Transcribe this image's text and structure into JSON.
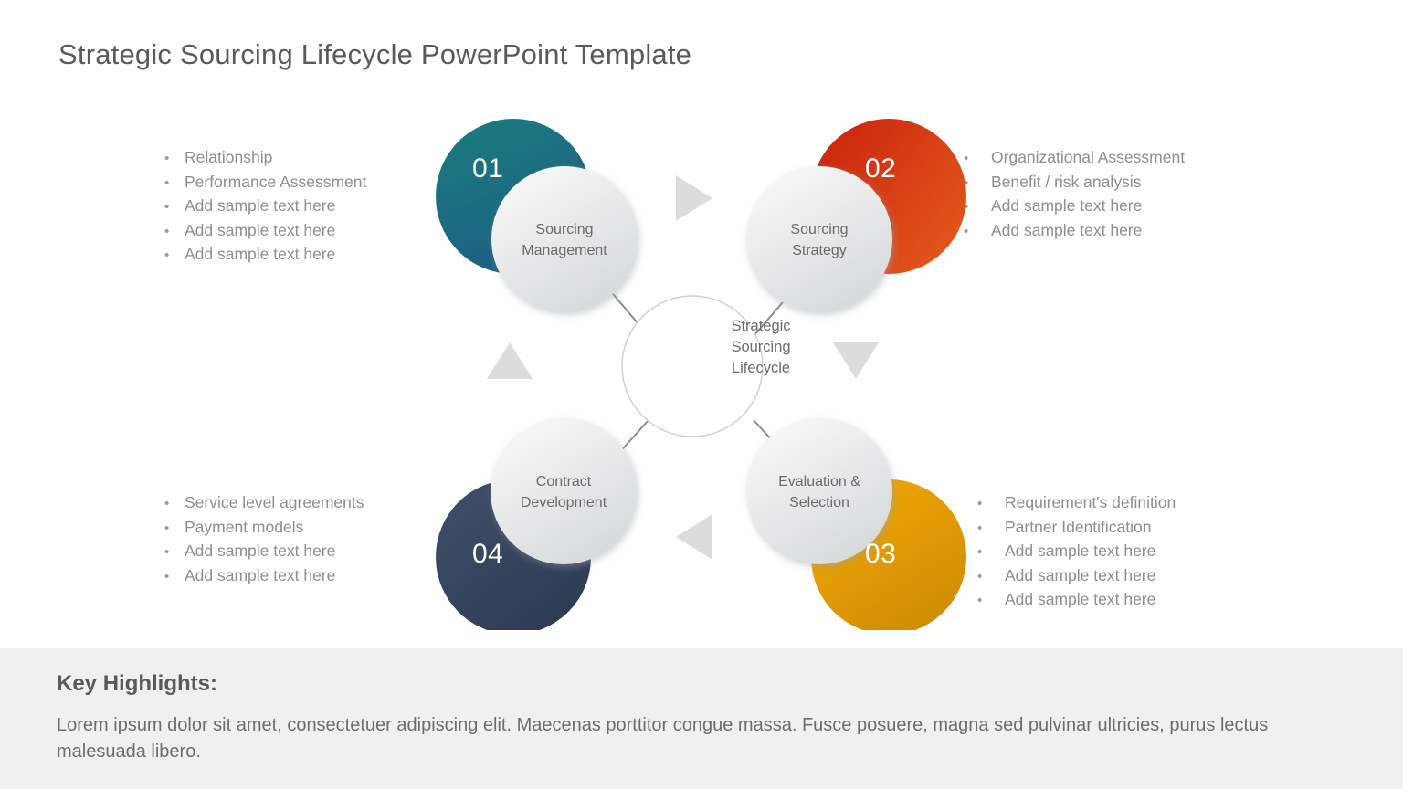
{
  "slide": {
    "title": "Strategic Sourcing Lifecycle PowerPoint Template",
    "background": "#ffffff"
  },
  "diagram": {
    "center": {
      "line1": "Strategic",
      "line2": "Sourcing",
      "line3": "Lifecycle",
      "border_color": "#cfcfcf"
    },
    "nodes": [
      {
        "number": "01",
        "label_line1": "Sourcing",
        "label_line2": "Management",
        "color_start": "#1a7d7e",
        "color_end": "#1d5f82",
        "position": "top-left"
      },
      {
        "number": "02",
        "label_line1": "Sourcing",
        "label_line2": "Strategy",
        "color_start": "#c9200d",
        "color_end": "#e2571a",
        "position": "top-right"
      },
      {
        "number": "03",
        "label_line1": "Evaluation &",
        "label_line2": "Selection",
        "color_start": "#f2a900",
        "color_end": "#d08c06",
        "position": "bottom-right"
      },
      {
        "number": "04",
        "label_line1": "Contract",
        "label_line2": "Development",
        "color_start": "#3b4a63",
        "color_end": "#2d3b52",
        "position": "bottom-left"
      }
    ],
    "arrows": [
      {
        "name": "arrow-right",
        "direction": "right"
      },
      {
        "name": "arrow-down",
        "direction": "down"
      },
      {
        "name": "arrow-left",
        "direction": "left"
      },
      {
        "name": "arrow-up",
        "direction": "up"
      }
    ],
    "connector_color": "#8c8c8c",
    "arrow_color": "#dcdcdc"
  },
  "lists": {
    "top_left": [
      "Relationship",
      "Performance  Assessment",
      "Add sample text here",
      "Add sample text here",
      "Add sample text here"
    ],
    "top_right": [
      "Organizational Assessment",
      "Benefit / risk analysis",
      "Add sample text here",
      "Add sample text here"
    ],
    "bottom_left": [
      "Service  level agreements",
      "Payment models",
      "Add sample text here",
      "Add sample text here"
    ],
    "bottom_right": [
      "Requirement's  definition",
      "Partner Identification",
      "Add sample text here",
      "Add sample text here",
      "Add sample text here"
    ],
    "bullet_glyph": "•"
  },
  "key_highlights": {
    "title": "Key Highlights:",
    "body": "Lorem ipsum dolor sit amet, consectetuer adipiscing elit. Maecenas porttitor congue massa. Fusce posuere, magna sed pulvinar ultricies, purus lectus malesuada libero.",
    "background": "#f0f0f0"
  }
}
